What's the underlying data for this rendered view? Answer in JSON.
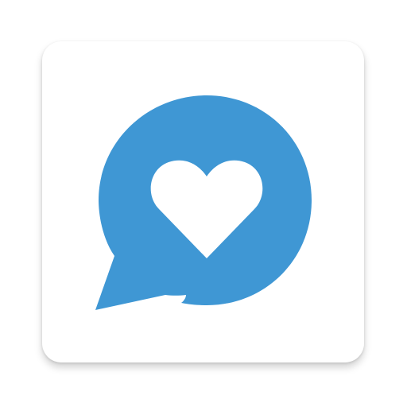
{
  "icon": {
    "name": "chat-heart-icon",
    "colors": {
      "bubble": "#3f97d4",
      "heart": "#ffffff",
      "tile": "#ffffff"
    }
  }
}
